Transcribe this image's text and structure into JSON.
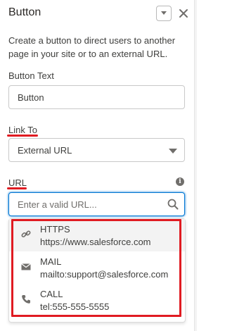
{
  "header": {
    "title": "Button"
  },
  "description": "Create a button to direct users to another page in your site or to an external URL.",
  "button_text": {
    "label": "Button Text",
    "value": "Button"
  },
  "link_to": {
    "label": "Link To",
    "value": "External URL"
  },
  "url": {
    "label": "URL",
    "placeholder": "Enter a valid URL..."
  },
  "options": [
    {
      "title": "HTTPS",
      "subtitle": "https://www.salesforce.com",
      "icon": "link-icon"
    },
    {
      "title": "MAIL",
      "subtitle": "mailto:support@salesforce.com",
      "icon": "mail-icon"
    },
    {
      "title": "CALL",
      "subtitle": "tel:555-555-5555",
      "icon": "phone-icon"
    }
  ],
  "colors": {
    "highlight": "#e01b22",
    "focus": "#0176d3"
  }
}
